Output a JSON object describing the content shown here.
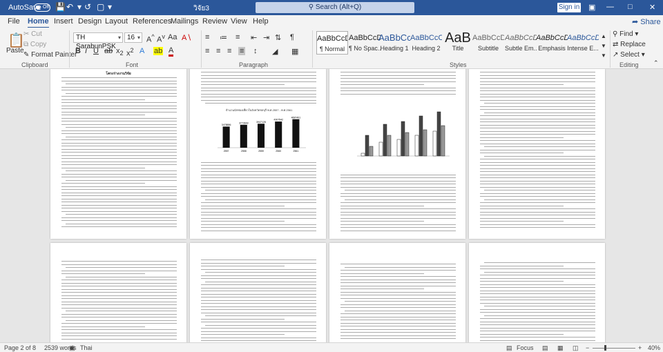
{
  "titlebar": {
    "autosave_label": "AutoSave",
    "autosave_state": "Off",
    "doc_title": "วิจัย3",
    "search_placeholder": "Search (Alt+Q)",
    "signin_label": "Sign in"
  },
  "menu": {
    "tabs": [
      "File",
      "Home",
      "Insert",
      "Design",
      "Layout",
      "References",
      "Mailings",
      "Review",
      "View",
      "Help"
    ],
    "active_tab": "Home",
    "share_label": "Share"
  },
  "ribbon": {
    "clipboard": {
      "paste": "Paste",
      "cut": "Cut",
      "copy": "Copy",
      "format_painter": "Format Painter",
      "label": "Clipboard"
    },
    "font": {
      "name": "TH SarabunPSK",
      "size": "16",
      "label": "Font"
    },
    "paragraph": {
      "label": "Paragraph"
    },
    "styles": {
      "label": "Styles",
      "items": [
        {
          "preview": "AaBbCcDd",
          "name": "¶ Normal"
        },
        {
          "preview": "AaBbCcDd",
          "name": "¶ No Spac..."
        },
        {
          "preview": "AaBbCc",
          "name": "Heading 1"
        },
        {
          "preview": "AaBbCcC",
          "name": "Heading 2"
        },
        {
          "preview": "AaB",
          "name": "Title"
        },
        {
          "preview": "AaBbCcD",
          "name": "Subtitle"
        },
        {
          "preview": "AaBbCcDd",
          "name": "Subtle Em..."
        },
        {
          "preview": "AaBbCcDd",
          "name": "Emphasis"
        },
        {
          "preview": "AaBbCcDd",
          "name": "Intense E..."
        }
      ]
    },
    "editing": {
      "find": "Find",
      "replace": "Replace",
      "select": "Select",
      "label": "Editing"
    }
  },
  "document": {
    "page1_title": "โครงร่างงานวิจัย"
  },
  "chart_data": {
    "type": "bar",
    "categories": [
      "2557",
      "2558",
      "2559",
      "2560",
      "2561"
    ],
    "values": [
      3478886,
      3773643,
      3947128,
      4307542,
      4687401
    ],
    "title": "จำนวนนักท่องเที่ยวในจังหวัดชลบุรี พ.ศ.2557 - พ.ศ.2561"
  },
  "status": {
    "page": "Page 2 of 8",
    "words": "2539 words",
    "language": "Thai",
    "focus": "Focus",
    "zoom": "40%"
  },
  "colors": {
    "brand": "#2b579a",
    "ribbon_bg": "#f3f3f3",
    "workspace_bg": "#e6e6e6"
  }
}
